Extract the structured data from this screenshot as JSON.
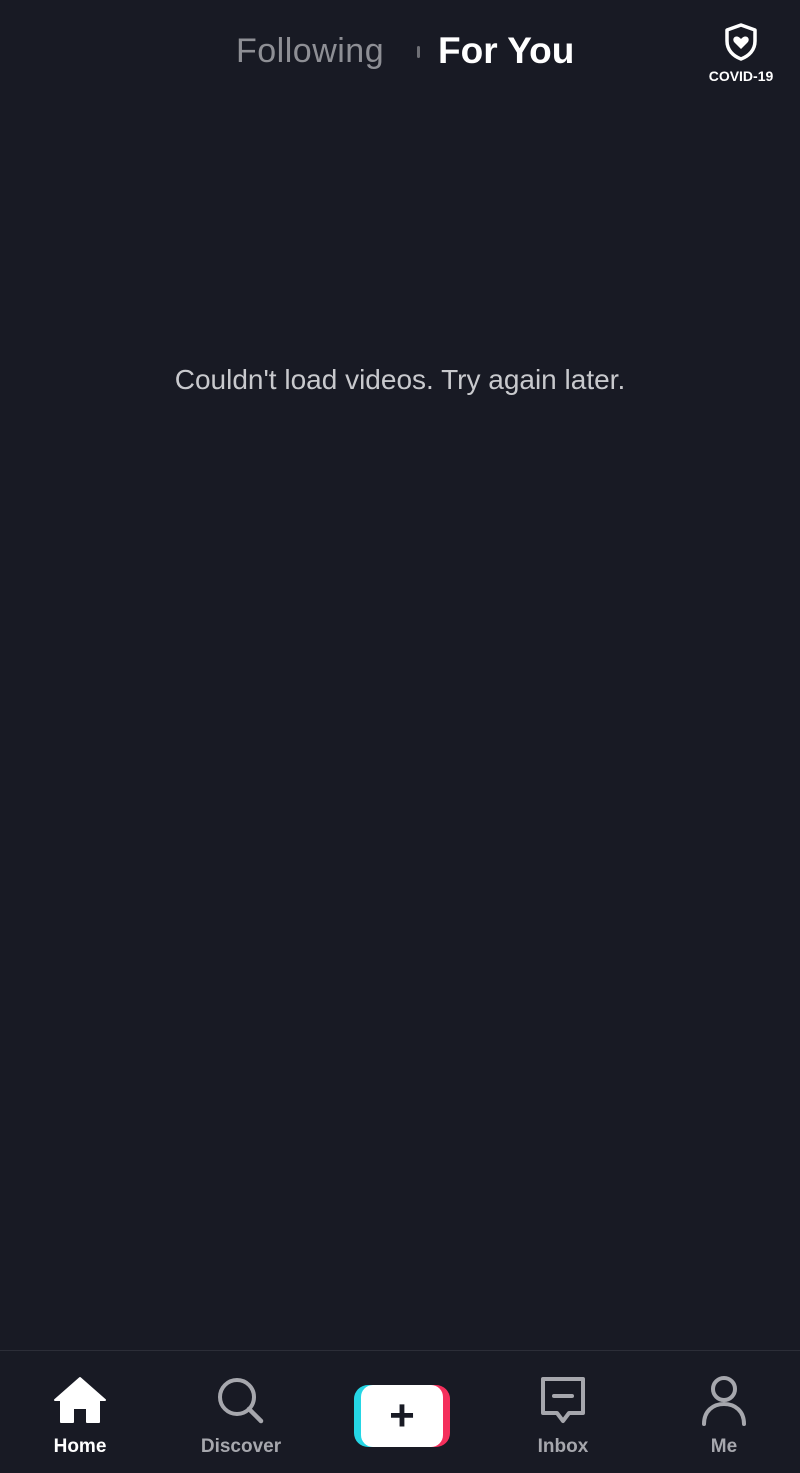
{
  "top_tabs": {
    "following": "Following",
    "for_you": "For You"
  },
  "covid": {
    "label": "COVID-19",
    "icon": "shield-heart-icon"
  },
  "feed": {
    "message": "Couldn't load videos. Try again later."
  },
  "bottom_nav": {
    "home": "Home",
    "discover": "Discover",
    "add_symbol": "+",
    "inbox": "Inbox",
    "me": "Me",
    "active": "home"
  },
  "colors": {
    "background": "#181a24",
    "accent_cyan": "#25d6e5",
    "accent_pink": "#f42f5c",
    "text_active": "#ffffff",
    "text_inactive": "#a6a7ad"
  }
}
